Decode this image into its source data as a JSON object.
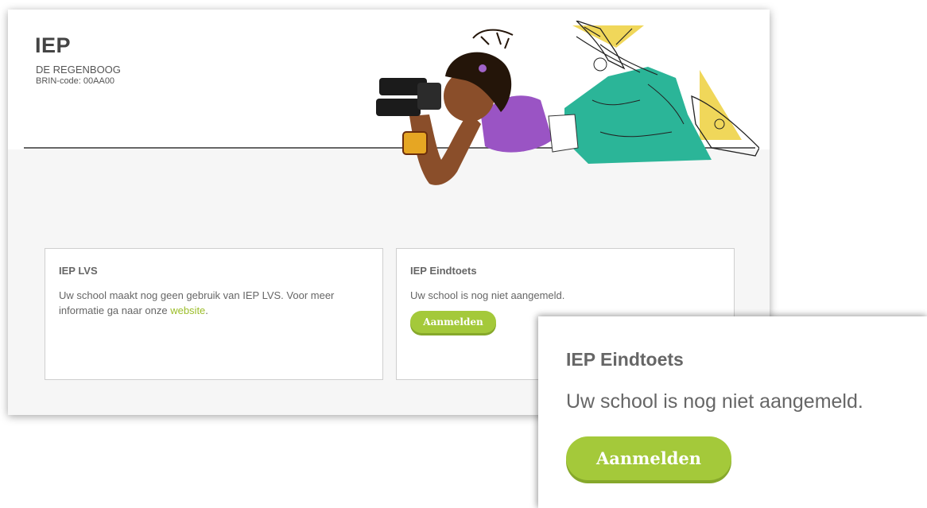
{
  "header": {
    "title": "IEP",
    "school_name": "DE REGENBOOG",
    "brin_code": "BRIN-code: 00AA00"
  },
  "cards": {
    "lvs": {
      "title": "IEP LVS",
      "text_before_link": "Uw school maakt nog geen gebruik van IEP LVS. Voor meer informatie ga naar onze ",
      "link_label": "website",
      "text_after_link": "."
    },
    "eindtoets": {
      "title": "IEP Eindtoets",
      "text": "Uw school is nog niet aangemeld.",
      "button_label": "Aanmelden"
    }
  },
  "zoom_callout": {
    "title": "IEP Eindtoets",
    "text": "Uw school is nog niet aangemeld.",
    "button_label": "Aanmelden"
  },
  "colors": {
    "accent_green": "#a4c93a",
    "link_green": "#9cbd2a",
    "content_bg": "#f6f6f6"
  },
  "illustration": "girl-with-binoculars-illustration"
}
